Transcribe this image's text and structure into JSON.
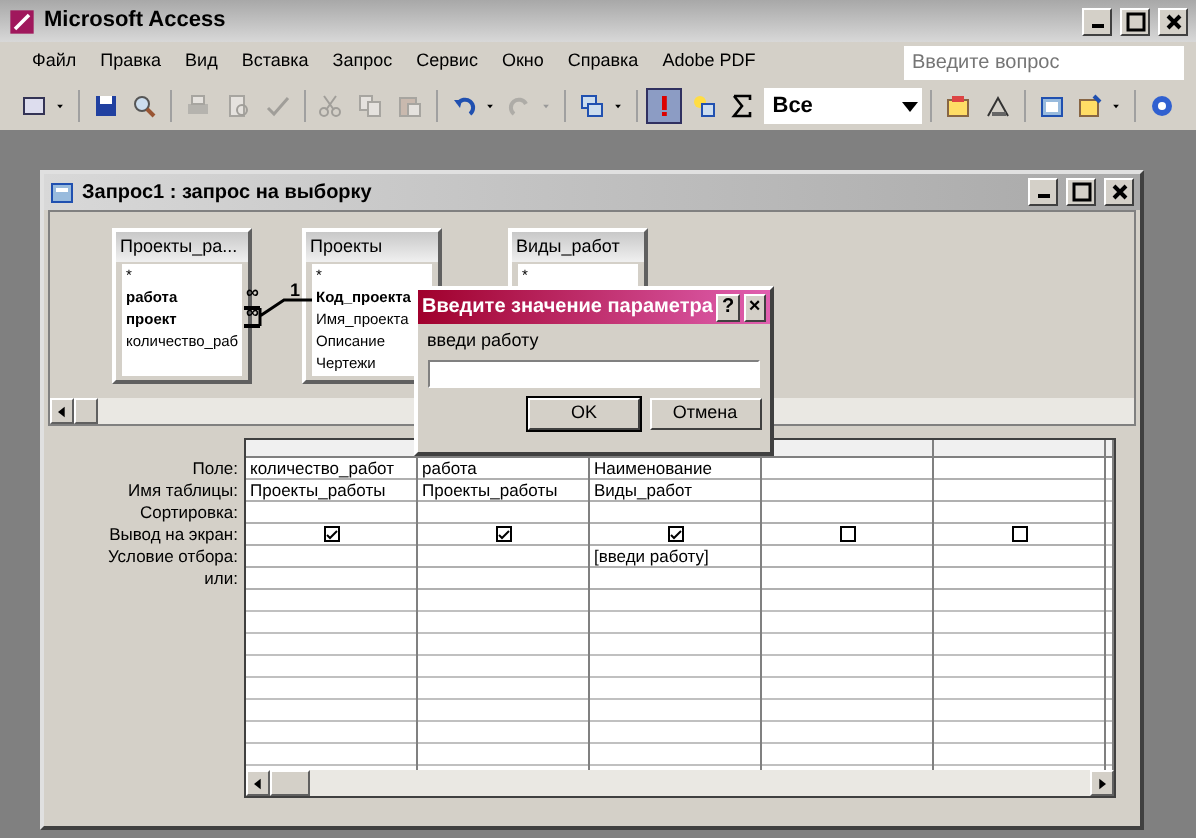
{
  "app": {
    "title": "Microsoft Access"
  },
  "menu": [
    "Файл",
    "Правка",
    "Вид",
    "Вставка",
    "Запрос",
    "Сервис",
    "Окно",
    "Справка",
    "Adobe PDF"
  ],
  "help_box": {
    "placeholder": "Введите вопрос"
  },
  "toolbar": [
    {
      "kind": "button",
      "disabled": false,
      "dropdown": true
    },
    {
      "kind": "separator"
    },
    {
      "kind": "button",
      "disabled": false
    },
    {
      "kind": "button",
      "disabled": false
    },
    {
      "kind": "separator"
    },
    {
      "kind": "button",
      "disabled": true
    },
    {
      "kind": "button",
      "disabled": true
    },
    {
      "kind": "button",
      "disabled": true
    },
    {
      "kind": "separator"
    },
    {
      "kind": "button",
      "disabled": true
    },
    {
      "kind": "button",
      "disabled": true
    },
    {
      "kind": "button",
      "disabled": true
    },
    {
      "kind": "separator"
    },
    {
      "kind": "button",
      "disabled": false,
      "dropdown": true
    },
    {
      "kind": "button",
      "disabled": true,
      "dropdown": true
    },
    {
      "kind": "separator"
    },
    {
      "kind": "button",
      "disabled": false,
      "dropdown": true
    },
    {
      "kind": "separator"
    },
    {
      "kind": "button",
      "disabled": false,
      "pressed": true
    },
    {
      "kind": "button",
      "disabled": false
    },
    {
      "kind": "button",
      "disabled": false
    },
    {
      "kind": "combo",
      "value": "Все"
    },
    {
      "kind": "separator"
    },
    {
      "kind": "button",
      "disabled": false
    },
    {
      "kind": "button",
      "disabled": false
    },
    {
      "kind": "separator"
    },
    {
      "kind": "button",
      "disabled": false
    },
    {
      "kind": "button",
      "disabled": false,
      "dropdown": true
    },
    {
      "kind": "separator"
    },
    {
      "kind": "button",
      "disabled": false
    }
  ],
  "query_window": {
    "title": "Запрос1 : запрос на выборку",
    "tables": [
      {
        "name": "Проекты_ра...",
        "fields": [
          {
            "name": "*",
            "key": false
          },
          {
            "name": "работа",
            "key": true
          },
          {
            "name": "проект",
            "key": true
          },
          {
            "name": "количество_раб",
            "key": false
          }
        ]
      },
      {
        "name": "Проекты",
        "fields": [
          {
            "name": "*",
            "key": false
          },
          {
            "name": "Код_проекта",
            "key": true
          },
          {
            "name": "Имя_проекта",
            "key": false
          },
          {
            "name": "Описание",
            "key": false
          },
          {
            "name": "Чертежи",
            "key": false
          }
        ]
      },
      {
        "name": "Виды_работ",
        "fields": [
          {
            "name": "*",
            "key": false
          }
        ]
      }
    ],
    "relation": {
      "many_mark_top": "∞",
      "many_mark_bottom": "∞",
      "one_mark": "1"
    },
    "row_labels": [
      "Поле:",
      "Имя таблицы:",
      "Сортировка:",
      "Вывод на экран:",
      "Условие отбора:",
      "или:"
    ],
    "columns": [
      {
        "field": "количество_работ",
        "table": "Проекты_работы",
        "show": true
      },
      {
        "field": "работа",
        "table": "Проекты_работы",
        "show": true
      },
      {
        "field": "Наименование",
        "table": "Виды_работ",
        "show": true,
        "criteria": "[введи работу]"
      },
      {
        "show": false
      },
      {
        "show": false
      }
    ]
  },
  "dialog": {
    "title": "Введите значение параметра",
    "prompt": "введи работу",
    "help": "?",
    "close": "×",
    "buttons": [
      "OK",
      "Отмена"
    ]
  }
}
